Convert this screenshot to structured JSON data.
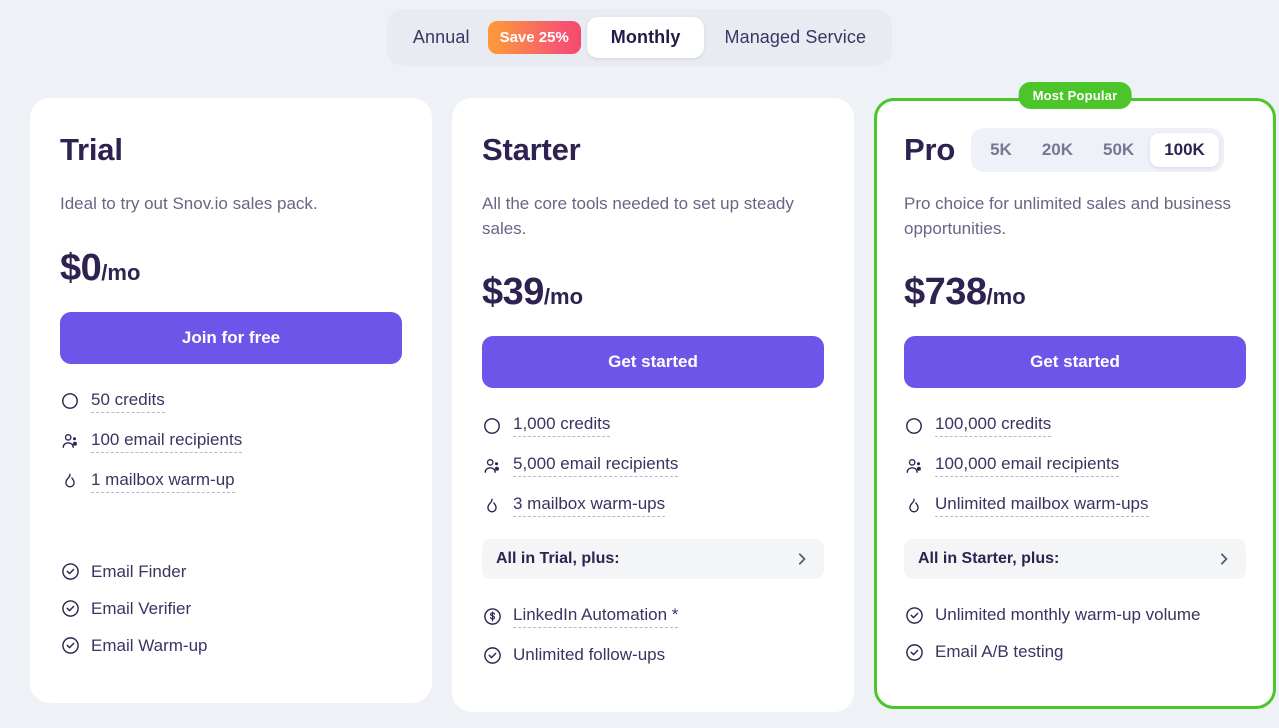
{
  "billing_toggle": {
    "options": [
      {
        "label": "Annual",
        "active": false
      },
      {
        "label": "Monthly",
        "active": true
      },
      {
        "label": "Managed Service",
        "active": false
      }
    ],
    "annual_label": "Annual",
    "save_badge": "Save 25%",
    "monthly_label": "Monthly",
    "managed_label": "Managed Service"
  },
  "colors": {
    "page_bg": "#eef1f6",
    "card_bg": "#ffffff",
    "accent_purple": "#6c55e8",
    "popular_green": "#4cc52a",
    "text_dark": "#2d2250",
    "text_muted": "#6a6486",
    "save_gradient_from": "#ff9a3c",
    "save_gradient_to": "#f5496c"
  },
  "plans": [
    {
      "name": "Trial",
      "description": "Ideal to try out Snov.io sales pack.",
      "price_amount": "$0",
      "price_period": "/mo",
      "cta_label": "Join for free",
      "quota_features": [
        {
          "icon": "credits-icon",
          "label": "50 credits"
        },
        {
          "icon": "recipients-icon",
          "label": "100 email recipients"
        },
        {
          "icon": "flame-icon",
          "label": "1 mailbox warm-up"
        }
      ],
      "plus_row": null,
      "features": [
        {
          "icon": "check-circle-icon",
          "label": "Email Finder"
        },
        {
          "icon": "check-circle-icon",
          "label": "Email Verifier"
        },
        {
          "icon": "check-circle-icon",
          "label": "Email Warm-up"
        }
      ]
    },
    {
      "name": "Starter",
      "description": "All the core tools needed to set up steady sales.",
      "price_amount": "$39",
      "price_period": "/mo",
      "cta_label": "Get started",
      "quota_features": [
        {
          "icon": "credits-icon",
          "label": "1,000 credits"
        },
        {
          "icon": "recipients-icon",
          "label": "5,000 email recipients"
        },
        {
          "icon": "flame-icon",
          "label": "3 mailbox warm-ups"
        }
      ],
      "plus_row": {
        "label": "All in Trial, plus:",
        "chevron": "chevron-right-icon"
      },
      "features": [
        {
          "icon": "dollar-circle-icon",
          "label": "LinkedIn Automation *",
          "dotted": true
        },
        {
          "icon": "check-circle-icon",
          "label": "Unlimited follow-ups"
        }
      ]
    },
    {
      "name": "Pro",
      "badge": "Most Popular",
      "description": "Pro choice for unlimited sales and business opportunities.",
      "price_amount": "$738",
      "price_period": "/mo",
      "cta_label": "Get started",
      "tiers": [
        {
          "label": "5K",
          "active": false
        },
        {
          "label": "20K",
          "active": false
        },
        {
          "label": "50K",
          "active": false
        },
        {
          "label": "100K",
          "active": true
        }
      ],
      "quota_features": [
        {
          "icon": "credits-icon",
          "label": "100,000 credits"
        },
        {
          "icon": "recipients-icon",
          "label": "100,000 email recipients"
        },
        {
          "icon": "flame-icon",
          "label": "Unlimited mailbox warm-ups"
        }
      ],
      "plus_row": {
        "label": "All in Starter, plus:",
        "chevron": "chevron-right-icon"
      },
      "features": [
        {
          "icon": "check-circle-icon",
          "label": "Unlimited monthly warm-up volume"
        },
        {
          "icon": "check-circle-icon",
          "label": "Email A/B testing"
        }
      ]
    }
  ]
}
